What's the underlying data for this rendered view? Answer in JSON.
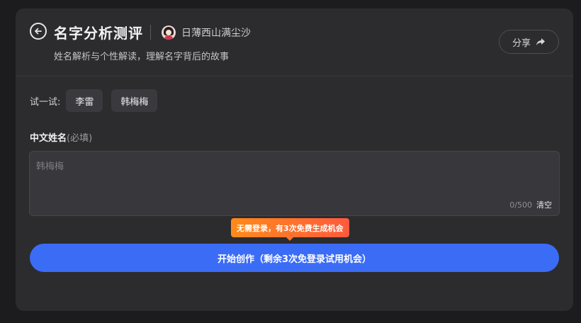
{
  "header": {
    "title": "名字分析测评",
    "author": "日薄西山满尘沙",
    "subtitle": "姓名解析与个性解读，理解名字背后的故事",
    "share_label": "分享"
  },
  "try": {
    "label": "试一试:",
    "chips": [
      "李雷",
      "韩梅梅"
    ]
  },
  "form": {
    "field_label": "中文姓名",
    "required": "(必填)",
    "value": "",
    "placeholder": "韩梅梅",
    "counter": "0/500",
    "clear_label": "清空"
  },
  "tooltip": "无需登录，有3次免费生成机会",
  "start_button": "开始创作（剩余3次免登录试用机会）",
  "colors": {
    "primary": "#3b6cf6",
    "tooltip_start": "#ff8a1a",
    "tooltip_end": "#ff5a3c",
    "card_bg": "#2c2c2f",
    "page_bg": "#1c1c1e"
  }
}
